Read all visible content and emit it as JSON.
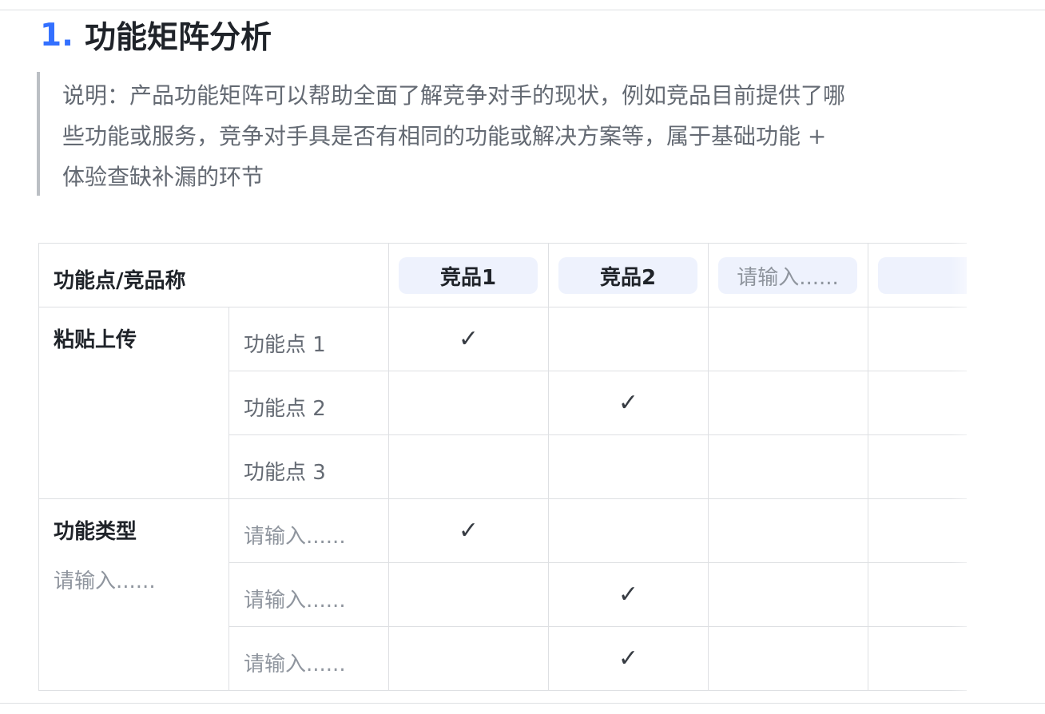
{
  "heading": {
    "number": "1.",
    "title": "功能矩阵分析"
  },
  "description": {
    "lines": [
      "说明：产品功能矩阵可以帮助全面了解竞争对手的现状，例如竞品目前提供了哪",
      "些功能或服务，竞争对手具是否有相同的功能或解决方案等，属于基础功能 +",
      "体验查缺补漏的环节"
    ]
  },
  "table": {
    "header_label": "功能点/竞品称",
    "competitors": [
      "竞品1",
      "竞品2",
      "请输入......",
      ""
    ],
    "check_symbol": "✓",
    "groups": [
      {
        "title": "粘贴上传",
        "subtitle": "",
        "rows": [
          {
            "feature": "功能点 1",
            "checks": [
              true,
              false,
              false,
              false
            ]
          },
          {
            "feature": "功能点 2",
            "checks": [
              false,
              true,
              false,
              false
            ]
          },
          {
            "feature": "功能点 3",
            "checks": [
              false,
              false,
              false,
              false
            ]
          }
        ]
      },
      {
        "title": "功能类型",
        "subtitle": "请输入......",
        "rows": [
          {
            "feature": "请输入......",
            "checks": [
              true,
              false,
              false,
              false
            ]
          },
          {
            "feature": "请输入......",
            "checks": [
              false,
              true,
              false,
              false
            ]
          },
          {
            "feature": "请输入......",
            "checks": [
              false,
              true,
              false,
              false
            ]
          }
        ]
      }
    ]
  },
  "colors": {
    "accent": "#3370ff",
    "pill_bg": "#eef2fd",
    "border": "#dee0e3",
    "muted_text": "#646a73"
  }
}
